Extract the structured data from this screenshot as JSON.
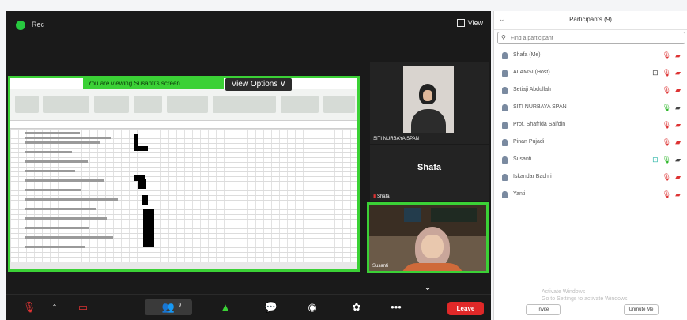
{
  "meeting": {
    "title": "Rec",
    "view_label": "View"
  },
  "share": {
    "banner": "You are viewing Susanti's screen",
    "view_options": "View Options ∨"
  },
  "tiles": [
    {
      "name": "SITI NURBAYA SPAN"
    },
    {
      "name": "Shafa",
      "mic_label": "Shafa"
    },
    {
      "name": "Susanti"
    }
  ],
  "toolbar": {
    "participants_count": "9",
    "leave_label": "Leave"
  },
  "participants": {
    "title": "Participants (9)",
    "search_placeholder": "Find a participant",
    "items": [
      {
        "name": "Shafa (Me)",
        "mic": "off",
        "video": "off"
      },
      {
        "name": "ALAMSI (Host)",
        "mic": "off",
        "video": "off",
        "sharing": true
      },
      {
        "name": "Setiaji Abdullah",
        "mic": "off",
        "video": "off"
      },
      {
        "name": "SITI NURBAYA SPAN",
        "mic": "on",
        "video": "on"
      },
      {
        "name": "Prof. Shafrida Saifdin",
        "mic": "off",
        "video": "off"
      },
      {
        "name": "Pinan Pujadi",
        "mic": "off",
        "video": "off"
      },
      {
        "name": "Susanti",
        "mic": "on",
        "video": "on",
        "sharing": true
      },
      {
        "name": "Iskandar Bachri",
        "mic": "off",
        "video": "off"
      },
      {
        "name": "Yanti",
        "mic": "off",
        "video": "off"
      }
    ],
    "invite_label": "Invite",
    "unmute_label": "Unmute Me",
    "watermark_line1": "Activate Windows",
    "watermark_line2": "Go to Settings to activate Windows."
  },
  "colors": {
    "share_border": "#3bd136",
    "leave": "#e02828",
    "mic_off": "#d33333",
    "mic_on": "#2fb72b"
  }
}
